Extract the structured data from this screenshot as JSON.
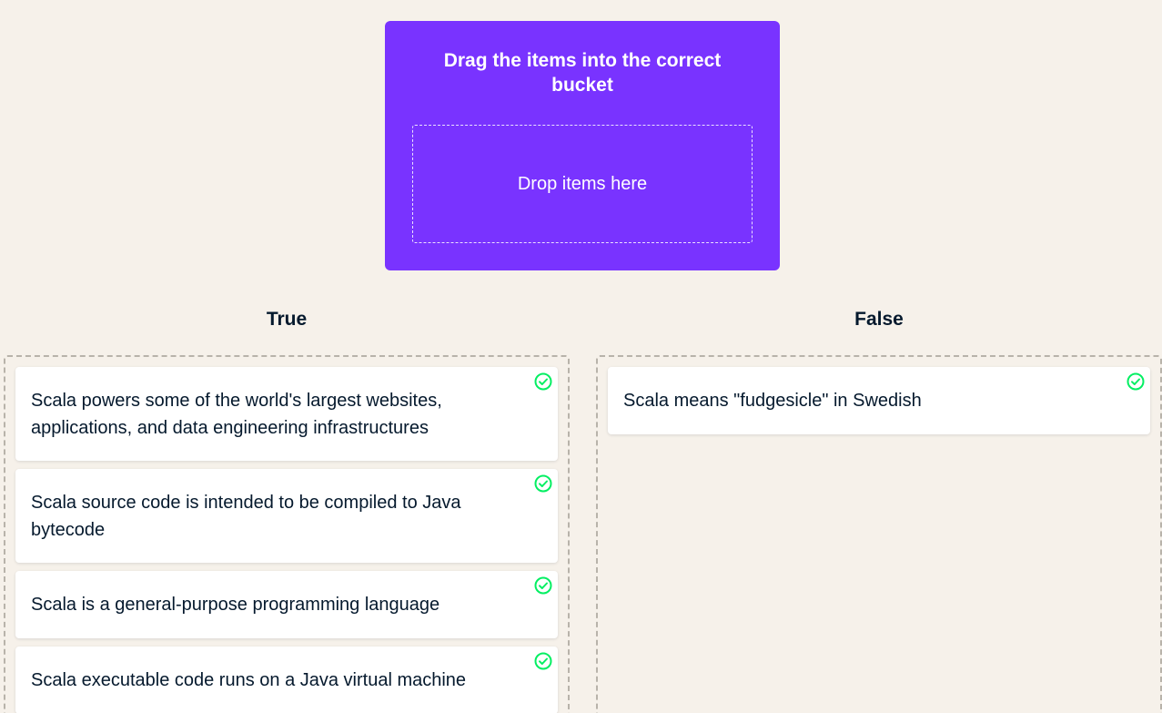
{
  "prompt": {
    "title": "Drag the items into the correct bucket",
    "drop_label": "Drop items here"
  },
  "buckets": [
    {
      "heading": "True",
      "items": [
        {
          "text": "Scala powers some of the world's largest websites, applications, and data engineering infrastructures",
          "status_icon": "check-circle-icon"
        },
        {
          "text": "Scala source code is intended to be compiled to Java bytecode",
          "status_icon": "check-circle-icon"
        },
        {
          "text": "Scala is a general-purpose programming language",
          "status_icon": "check-circle-icon"
        },
        {
          "text": "Scala executable code runs on a Java virtual machine",
          "status_icon": "check-circle-icon"
        }
      ]
    },
    {
      "heading": "False",
      "items": [
        {
          "text": "Scala means \"fudgesicle\" in Swedish",
          "status_icon": "check-circle-icon"
        }
      ]
    }
  ],
  "colors": {
    "background": "#f6f1ea",
    "prompt_card": "#7933ff",
    "correct_green": "#03ef62",
    "text": "#05192d"
  }
}
